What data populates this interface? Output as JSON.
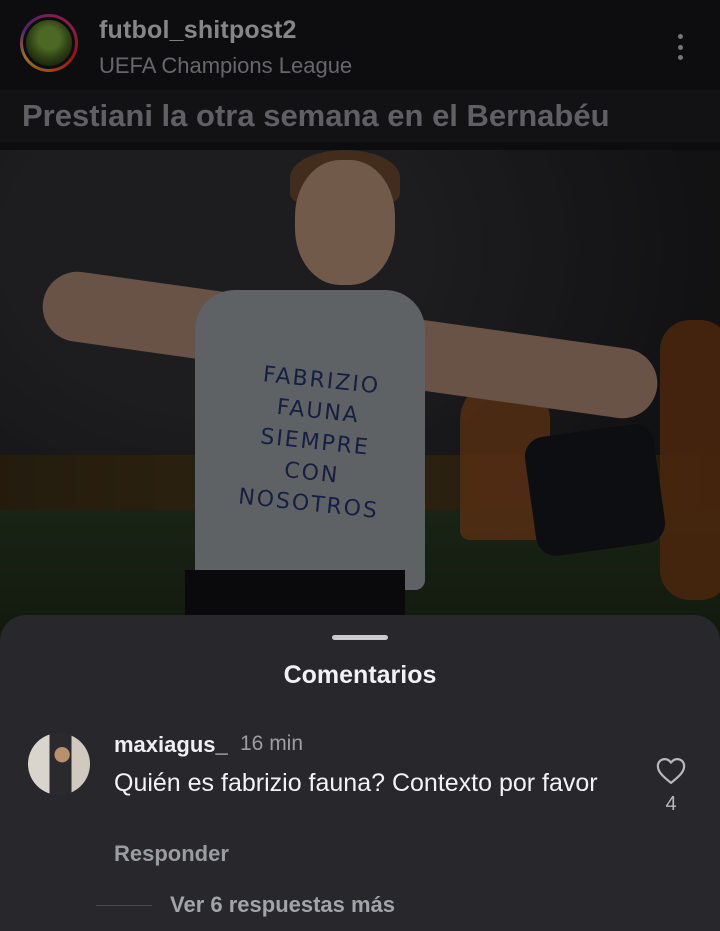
{
  "post": {
    "username": "futbol_shitpost2",
    "subtitle": "UEFA Champions League",
    "caption": "Prestiani la otra semana en el Bernabéu",
    "shirt_lines": [
      "FABRIZIO",
      "FAUNA",
      "SIEMPRE",
      "CON",
      "NOSOTROS"
    ],
    "more_icon": "more-vertical-icon"
  },
  "comments_sheet": {
    "title": "Comentarios",
    "comment": {
      "username": "maxiagus_",
      "time": "16 min",
      "text": "Quién es fabrizio fauna? Contexto por favor",
      "reply_label": "Responder",
      "like_icon": "heart-outline-icon",
      "like_count": "4",
      "view_replies_label": "Ver 6 respuestas más"
    }
  },
  "colors": {
    "background": "#161619",
    "sheet": "#27272c",
    "muted_text": "#9b9ba2"
  }
}
